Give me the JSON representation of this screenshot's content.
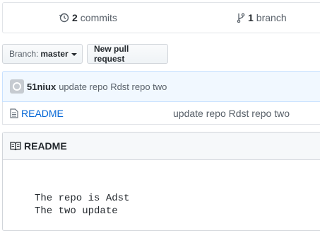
{
  "summary": {
    "commits_count": "2",
    "commits_label": "commits",
    "branches_count": "1",
    "branches_label": "branch"
  },
  "toolbar": {
    "branch_prefix": "Branch:",
    "branch_name": "master",
    "new_pr_label": "New pull request"
  },
  "latest_commit": {
    "author": "51niux",
    "message": "update repo Rdst repo two"
  },
  "files": [
    {
      "name": "README",
      "icon": "file-icon",
      "message": "update repo Rdst repo two"
    }
  ],
  "readme": {
    "title": "README",
    "lines": [
      "The repo is Adst",
      "The two update"
    ]
  },
  "colors": {
    "link": "#0366d6",
    "commit_bar_bg": "#f1f8ff",
    "commit_bar_border": "#c8e1ff"
  }
}
